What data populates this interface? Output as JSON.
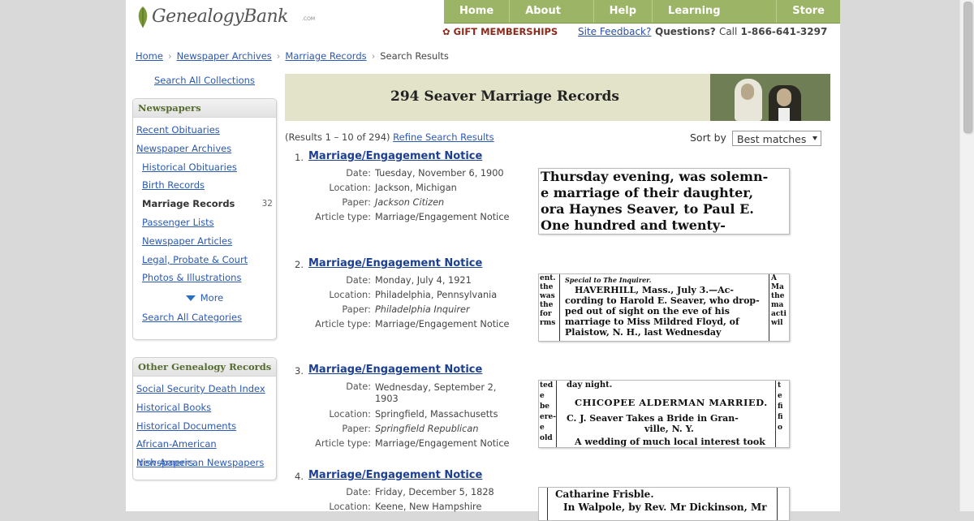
{
  "brand": {
    "name": "GenealogyBank",
    "suffix": ".COM"
  },
  "topnav": [
    "Home",
    "About Us",
    "Help",
    "Learning Center",
    "Store"
  ],
  "subheader": {
    "gift": "GIFT MEMBERSHIPS",
    "feedback": "Site Feedback?",
    "questions": "Questions?",
    "call": "Call",
    "phone": "1-866-641-3297"
  },
  "breadcrumb": {
    "items": [
      "Home",
      "Newspaper Archives",
      "Marriage Records"
    ],
    "current": "Search Results"
  },
  "left": {
    "search_all_collections": "Search All Collections",
    "newspapers": {
      "title": "Newspapers",
      "top_items": [
        "Recent Obituaries",
        "Newspaper Archives"
      ],
      "sub_items": [
        "Historical Obituaries",
        "Birth Records"
      ],
      "current": {
        "label": "Marriage Records",
        "count": "32"
      },
      "sub_items2": [
        "Passenger Lists",
        "Newspaper Articles",
        "Legal, Probate & Court",
        "Photos & Illustrations"
      ],
      "more": "More",
      "search_all_categories": "Search All Categories"
    },
    "other": {
      "title": "Other Genealogy Records",
      "items": [
        "Social Security Death Index",
        "Historical Books",
        "Historical Documents",
        "African-American Newspapers",
        "Irish-American Newspapers"
      ]
    }
  },
  "banner": {
    "title": "294 Seaver Marriage Records"
  },
  "results_meta": {
    "range": "(Results 1 – 10 of 294)",
    "refine": "Refine Search Results"
  },
  "sort": {
    "label": "Sort by",
    "value": "Best matches"
  },
  "labels": {
    "date": "Date:",
    "location": "Location:",
    "paper": "Paper:",
    "type": "Article type:"
  },
  "results": [
    {
      "num": "1.",
      "title": "Marriage/Engagement Notice",
      "date": "Tuesday, November 6, 1900",
      "location": "Jackson, Michigan",
      "paper": "Jackson Citizen",
      "type": "Marriage/Engagement Notice",
      "snippet": [
        "Thursday evening, was solemn-",
        "e marriage of their daughter,",
        "ora Haynes Seaver, to Paul E.",
        "   One hundred and twenty-"
      ]
    },
    {
      "num": "2.",
      "title": "Marriage/Engagement Notice",
      "date": "Monday, July 4, 1921",
      "location": "Philadelphia, Pennsylvania",
      "paper": "Philadelphia Inquirer",
      "type": "Marriage/Engagement Notice",
      "snippet": [
        "Special to The Inquirer.",
        "HAVERHILL, Mass., July 3.—Ac-",
        "cording to Harold E. Seaver, who drop-",
        "ped out of sight on the eve of his",
        "marriage to Miss Mildred Floyd, of",
        "Plaistow, N. H., last Wednesday"
      ]
    },
    {
      "num": "3.",
      "title": "Marriage/Engagement Notice",
      "date": "Wednesday, September 2, 1903",
      "location": "Springfield, Massachusetts",
      "paper": "Springfield Republican",
      "type": "Marriage/Engagement Notice",
      "snippet": [
        "day night.",
        "CHICOPEE ALDERMAN MARRIED.",
        "C. J. Seaver Takes a Bride in Gran-",
        "ville, N. Y.",
        "A wedding of much local interest took"
      ]
    },
    {
      "num": "4.",
      "title": "Marriage/Engagement Notice",
      "date": "Friday, December 5, 1828",
      "location": "Keene, New Hampshire",
      "paper": "",
      "type": "",
      "snippet": [
        "Catharine Frisble.",
        "In Walpole, by Rev. Mr Dickinson, Mr"
      ]
    }
  ]
}
